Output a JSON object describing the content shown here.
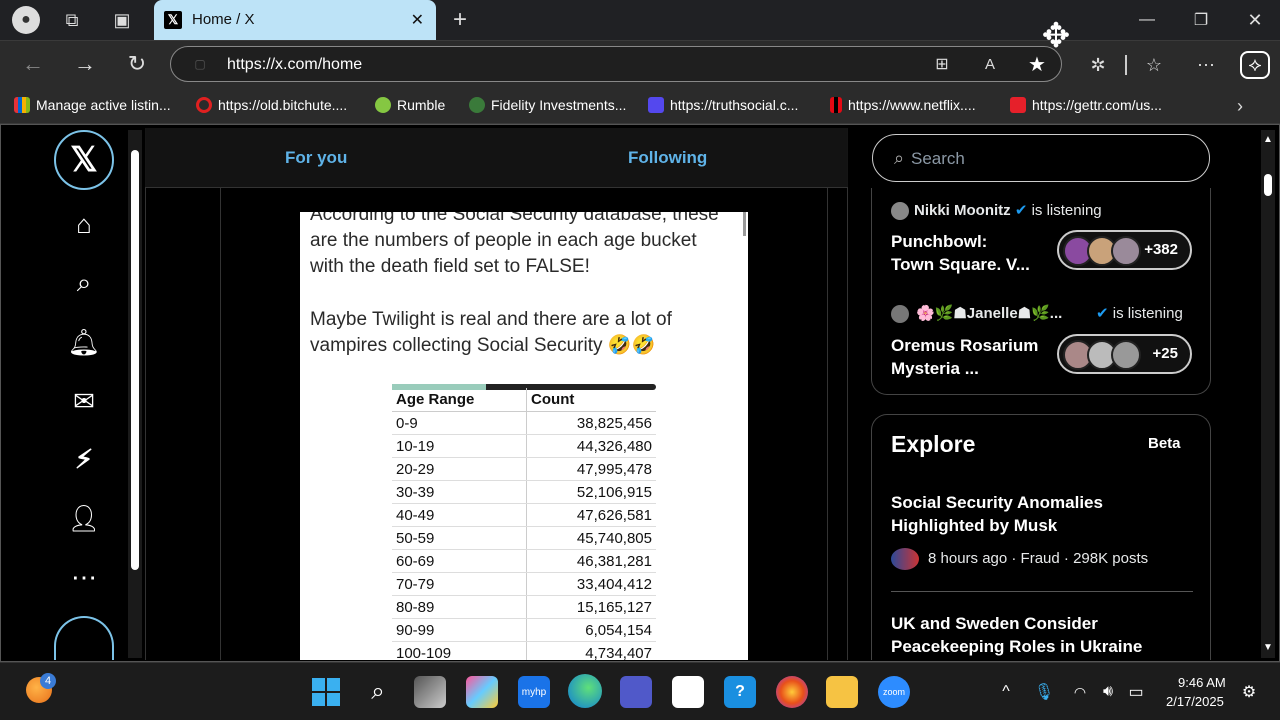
{
  "browser": {
    "tab_title": "Home / X",
    "url": "https://x.com/home",
    "bookmarks": [
      "Manage active listin...",
      "https://old.bitchute....",
      "Rumble",
      "Fidelity Investments...",
      "https://truthsocial.c...",
      "https://www.netflix....",
      "https://gettr.com/us..."
    ]
  },
  "header": {
    "tab_for_you": "For you",
    "tab_following": "Following"
  },
  "post": {
    "line1": "According to the Social Security database, these",
    "line2": "are the numbers of people in each age bucket",
    "line3": "with the death field set to FALSE!",
    "line4": "Maybe Twilight is real and there are a lot of",
    "line5": "vampires collecting Social Security 🤣🤣",
    "table_headers": [
      "Age Range",
      "Count"
    ],
    "rows": [
      [
        "0-9",
        "38,825,456"
      ],
      [
        "10-19",
        "44,326,480"
      ],
      [
        "20-29",
        "47,995,478"
      ],
      [
        "30-39",
        "52,106,915"
      ],
      [
        "40-49",
        "47,626,581"
      ],
      [
        "50-59",
        "45,740,805"
      ],
      [
        "60-69",
        "46,381,281"
      ],
      [
        "70-79",
        "33,404,412"
      ],
      [
        "80-89",
        "15,165,127"
      ],
      [
        "90-99",
        "6,054,154"
      ],
      [
        "100-109",
        "4,734,407"
      ]
    ]
  },
  "sidebar": {
    "search_placeholder": "Search",
    "space1": {
      "host": "Nikki Moonitz",
      "status": "is listening",
      "title1": "Punchbowl:",
      "title2": "Town Square. V...",
      "count": "+382"
    },
    "space2": {
      "host": "🌸🌿☗Janelle☗🌿...",
      "status": "is listening",
      "title1": "Oremus Rosarium",
      "title2": "Mysteria ...",
      "count": "+25"
    },
    "explore": {
      "title": "Explore",
      "badge": "Beta",
      "item1_title1": "Social Security Anomalies",
      "item1_title2": "Highlighted by Musk",
      "item1_meta": "8 hours ago · Fraud · 298K posts",
      "item2_title1": "UK and Sweden Consider",
      "item2_title2": "Peacekeeping Roles in Ukraine"
    }
  },
  "taskbar": {
    "time": "9:46 AM",
    "date": "2/17/2025",
    "badge": "4"
  },
  "colors": {
    "accent": "#1d9bf0",
    "tab_active": "#bde3f7"
  }
}
